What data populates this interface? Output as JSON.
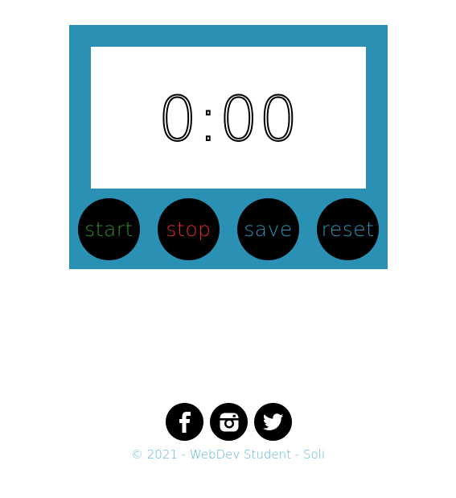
{
  "stopwatch": {
    "time": "0:00"
  },
  "buttons": [
    {
      "label": "start",
      "color": "#2e8b2e"
    },
    {
      "label": "stop",
      "color": "#e0282b"
    },
    {
      "label": "save",
      "color": "#2a90b4"
    },
    {
      "label": "reset",
      "color": "#2a90b4"
    }
  ],
  "colors": {
    "frame": "#2a90b4",
    "display_background": "#ffffff",
    "button_background": "#000000",
    "footer_text": "#5ab3d4"
  },
  "social": [
    {
      "name": "facebook-icon"
    },
    {
      "name": "instagram-icon"
    },
    {
      "name": "twitter-icon"
    }
  ],
  "footer": {
    "copyright": "© 2021 - WebDev Student - Soli"
  }
}
